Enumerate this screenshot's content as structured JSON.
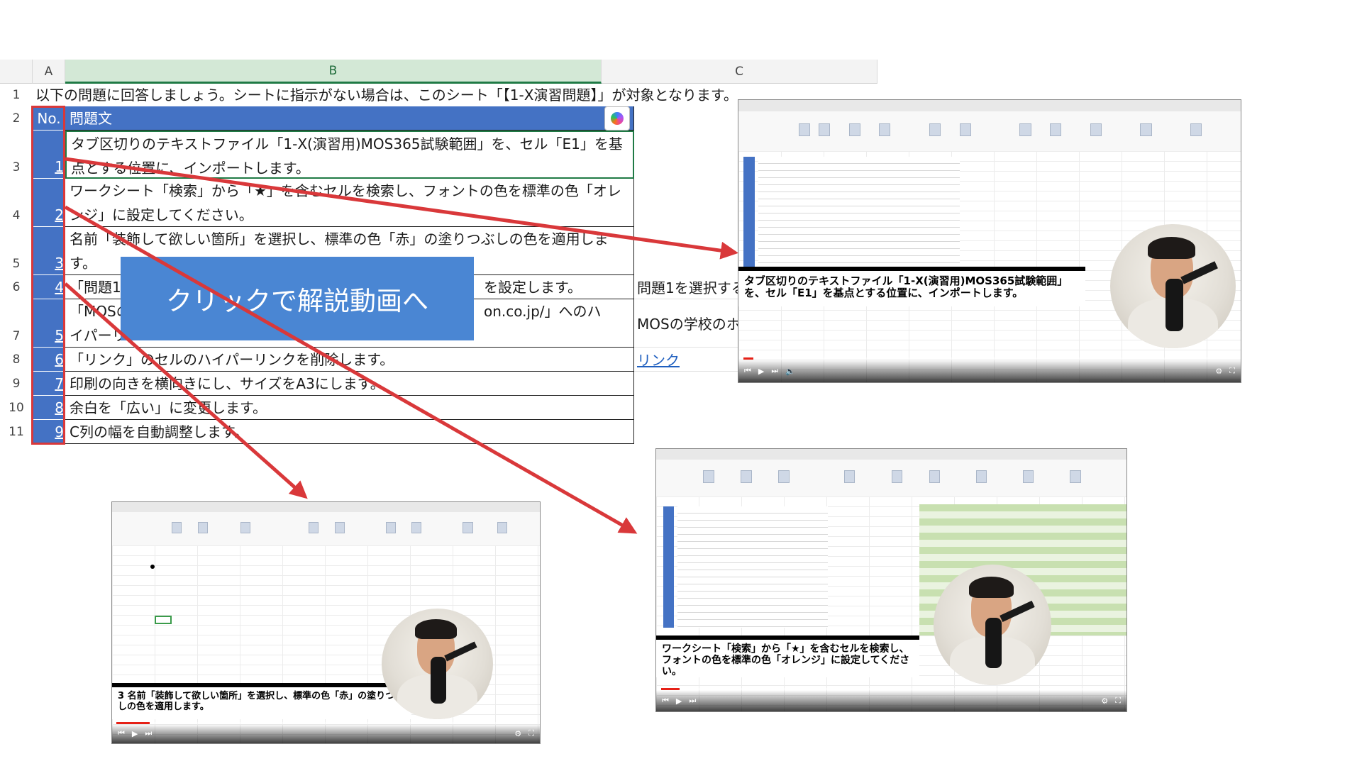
{
  "sheet": {
    "columns": [
      "A",
      "B",
      "C"
    ],
    "row_numbers": [
      "1",
      "2",
      "3",
      "4",
      "5",
      "6",
      "7",
      "8",
      "9",
      "10",
      "11"
    ],
    "row1_text": "以下の問題に回答しましょう。シートに指示がない場合は、このシート「【1-X演習問題】」が対象となります。",
    "header": {
      "no": "No.",
      "question": "問題文"
    },
    "rows": [
      {
        "no": "1",
        "text": "タブ区切りのテキストファイル「1-X(演習用)MOS365試験範囲」を、セル「E1」を基点とする位置に、インポートします。",
        "c": ""
      },
      {
        "no": "2",
        "text": "ワークシート「検索」から「★」を含むセルを検索し、フォントの色を標準の色「オレンジ」に設定してください。",
        "c": ""
      },
      {
        "no": "3",
        "text": "名前「装飾して欲しい箇所」を選択し、標準の色「赤」の塗りつぶしの色を適用します。",
        "c": ""
      },
      {
        "no": "4",
        "text": "「問題1を",
        "text_end": "を設定します。",
        "c": "問題1を選択する"
      },
      {
        "no": "5",
        "text": "「MOSの",
        "text_end": "on.co.jp/」へのハ",
        "text2": "イパーリン",
        "c": "MOSの学校のホーム"
      },
      {
        "no": "6",
        "text": "「リンク」のセルのハイパーリンクを削除します。",
        "c": "リンク"
      },
      {
        "no": "7",
        "text": "印刷の向きを横向きにし、サイズをA3にします。",
        "c": ""
      },
      {
        "no": "8",
        "text": "余白を「広い」に変更します。",
        "c": ""
      },
      {
        "no": "9",
        "text": "C列の幅を自動調整します。",
        "c": ""
      }
    ]
  },
  "banner": {
    "label": "クリックで解説動画へ"
  },
  "videos": [
    {
      "caption": "タブ区切りのテキストファイル「1-X(演習用)MOS365試験範囲」を、セル「E1」を基点とする位置に、インポートします。"
    },
    {
      "caption": "3  名前「装飾して欲しい箇所」を選択し、標準の色「赤」の塗りつぶしの色を適用します。"
    },
    {
      "caption": "ワークシート「検索」から「★」を含むセルを検索し、フォントの色を標準の色「オレンジ」に設定してください。"
    }
  ],
  "colors": {
    "accent_blue": "#4472c4",
    "banner_blue": "#4a86d3",
    "arrow_red": "#d9383a",
    "excel_green": "#1f7a45"
  }
}
